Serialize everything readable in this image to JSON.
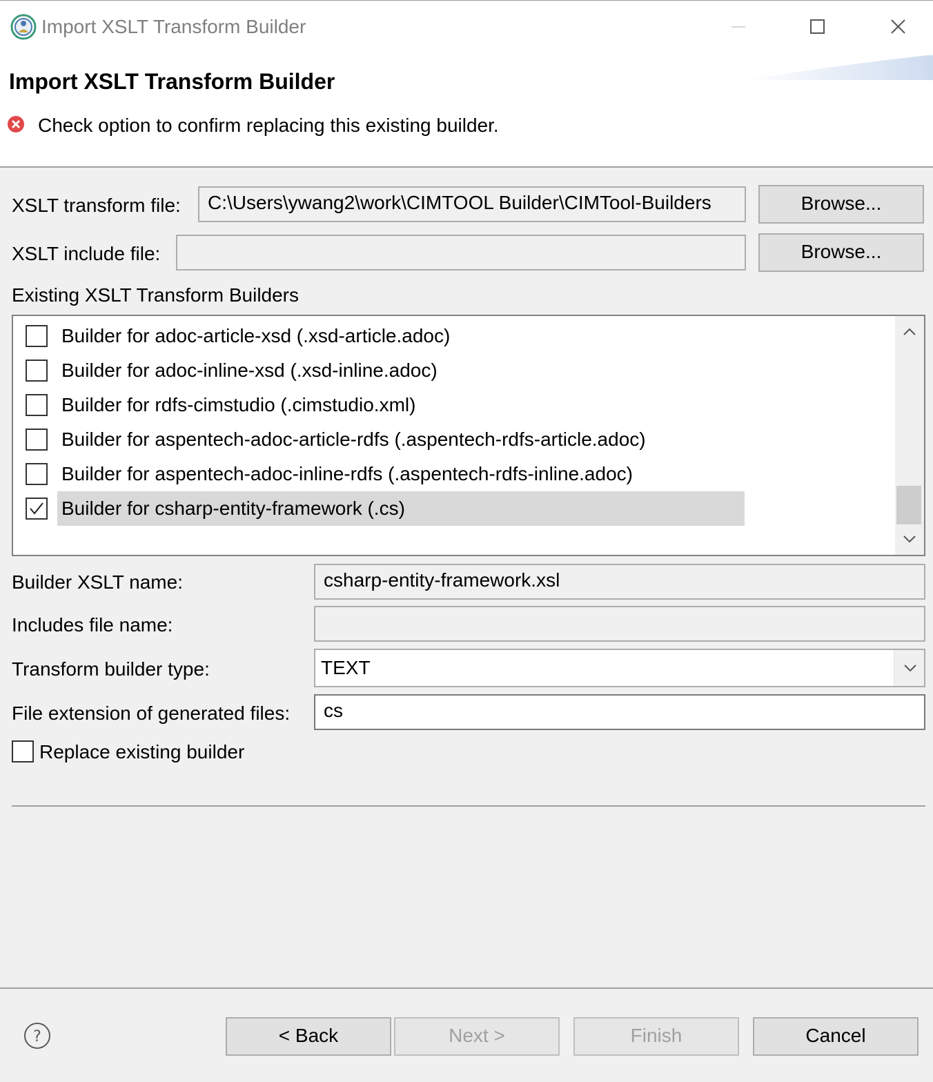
{
  "window": {
    "title": "Import XSLT Transform Builder",
    "icons": {
      "app": "app-logo-icon",
      "minimize": "minimize-icon",
      "maximize": "maximize-icon",
      "close": "close-icon"
    }
  },
  "header": {
    "title": "Import XSLT Transform Builder",
    "error_icon": "error-icon",
    "message": "Check option to confirm replacing this existing builder."
  },
  "form": {
    "transform_file": {
      "label": "XSLT transform file:",
      "value": "C:\\Users\\ywang2\\work\\CIMTOOL Builder\\CIMTool-Builders",
      "browse": "Browse..."
    },
    "include_file": {
      "label": "XSLT include file:",
      "value": "",
      "browse": "Browse..."
    },
    "existing_label": "Existing XSLT Transform Builders",
    "builders": [
      {
        "label": "Builder for adoc-article-xsd  (.xsd-article.adoc)",
        "checked": false
      },
      {
        "label": "Builder for adoc-inline-xsd  (.xsd-inline.adoc)",
        "checked": false
      },
      {
        "label": "Builder for rdfs-cimstudio  (.cimstudio.xml)",
        "checked": false
      },
      {
        "label": "Builder for aspentech-adoc-article-rdfs  (.aspentech-rdfs-article.adoc)",
        "checked": false
      },
      {
        "label": "Builder for aspentech-adoc-inline-rdfs  (.aspentech-rdfs-inline.adoc)",
        "checked": false
      },
      {
        "label": "Builder for csharp-entity-framework  (.cs)",
        "checked": true,
        "selected": true
      }
    ],
    "builder_name": {
      "label": "Builder XSLT name:",
      "value": "csharp-entity-framework.xsl"
    },
    "includes_name": {
      "label": "Includes file name:",
      "value": ""
    },
    "builder_type": {
      "label": "Transform builder type:",
      "value": "TEXT"
    },
    "extension": {
      "label": "File extension of generated files:",
      "value": "cs"
    },
    "replace": {
      "label": "Replace existing builder",
      "checked": false
    }
  },
  "footer": {
    "help_icon": "help-icon",
    "back": "< Back",
    "next": "Next >",
    "finish": "Finish",
    "cancel": "Cancel",
    "next_enabled": false,
    "finish_enabled": false
  },
  "colors": {
    "error": "#e0484a",
    "selection": "#d9d9d9",
    "background": "#f0f0f0"
  }
}
